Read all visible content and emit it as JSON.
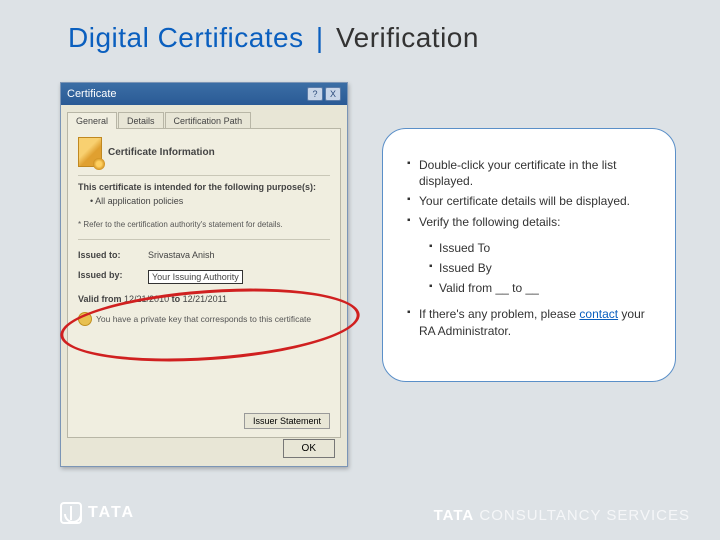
{
  "title": {
    "blue": "Digital Certificates",
    "sep": "|",
    "rest": "Verification"
  },
  "dialog": {
    "title": "Certificate",
    "help": "?",
    "close": "X",
    "tabs": {
      "general": "General",
      "details": "Details",
      "certpath": "Certification Path"
    },
    "info_title": "Certificate Information",
    "purpose_heading": "This certificate is intended for the following purpose(s):",
    "purpose_item": "• All application policies",
    "refer_note": "* Refer to the certification authority's statement for details.",
    "issued_to_label": "Issued to:",
    "issued_to_value": "Srivastava Anish",
    "issued_by_label": "Issued by:",
    "issued_by_value": "Your Issuing Authority",
    "valid_label": "Valid from",
    "valid_from": "12/21/2010",
    "valid_to_word": "to",
    "valid_to": "12/21/2011",
    "key_note": "You have a private key that corresponds to this certificate",
    "issuer_btn": "Issuer Statement",
    "ok": "OK"
  },
  "callout": {
    "b1": "Double-click your certificate in the list displayed.",
    "b2": "Your certificate details will be displayed.",
    "b3": "Verify the following details:",
    "s1": "Issued To",
    "s2": "Issued By",
    "s3": "Valid from __ to __",
    "b4a": "If there's any problem, please ",
    "b4link": "contact",
    "b4b": " your RA Administrator."
  },
  "footer": {
    "left": "TATA",
    "right_bold": "TATA",
    "right_light1": " CONSULTANCY ",
    "right_light2": "SERVICES"
  }
}
